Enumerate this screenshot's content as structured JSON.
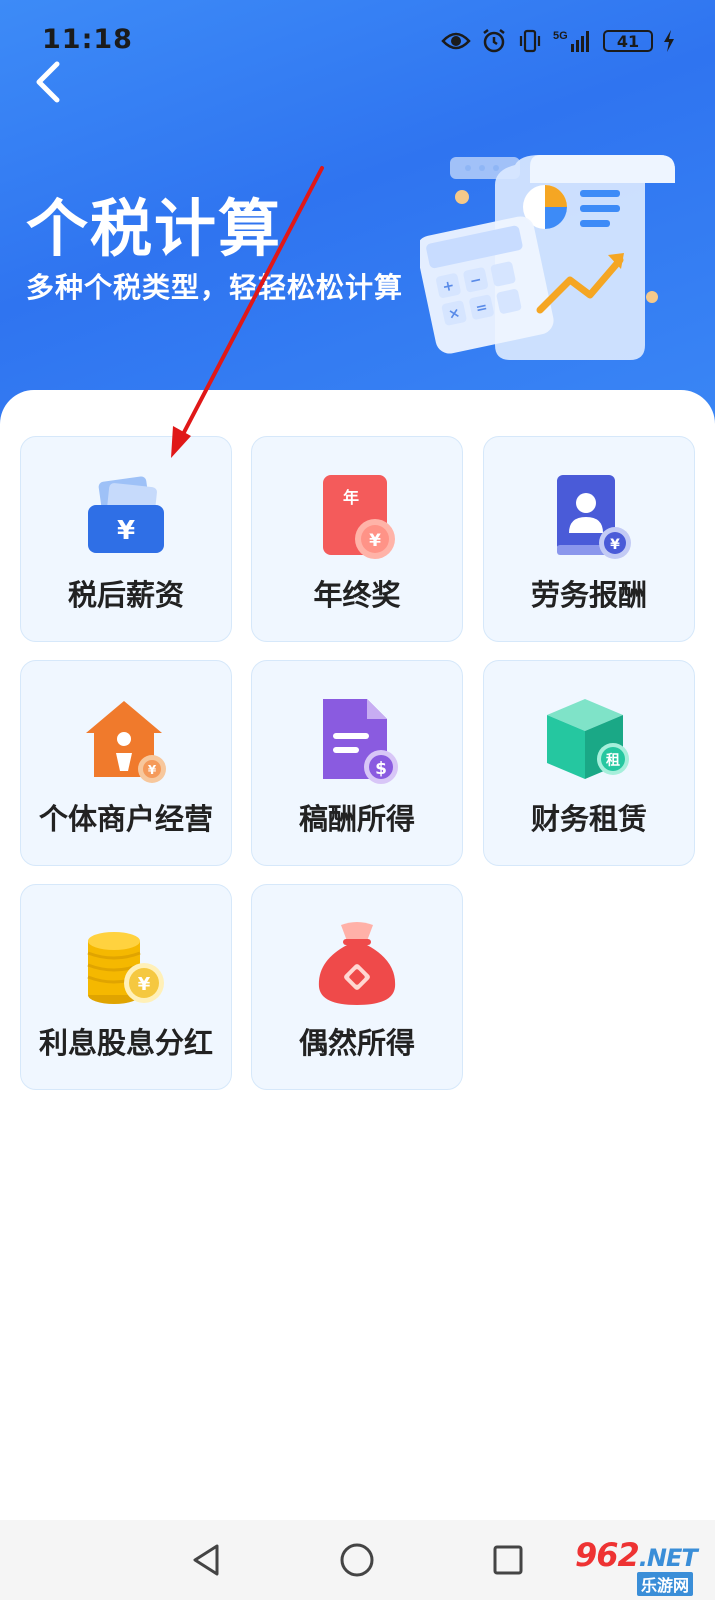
{
  "status_bar": {
    "time": "11:18",
    "network": "5G",
    "battery": "41"
  },
  "header": {
    "title": "个税计算",
    "subtitle": "多种个税类型，轻轻松松计算"
  },
  "grid": [
    {
      "label": "税后薪资",
      "icon": "wallet-yen-icon",
      "color": "#2f6fe6"
    },
    {
      "label": "年终奖",
      "icon": "red-envelope-year-icon",
      "color": "#f45b5b"
    },
    {
      "label": "劳务报酬",
      "icon": "contract-person-icon",
      "color": "#4a5bd8"
    },
    {
      "label": "个体商户经营",
      "icon": "shop-house-icon",
      "color": "#f07a2c"
    },
    {
      "label": "稿酬所得",
      "icon": "document-dollar-icon",
      "color": "#8a5be0"
    },
    {
      "label": "财务租赁",
      "icon": "rent-box-icon",
      "color": "#25c7a0"
    },
    {
      "label": "利息股息分红",
      "icon": "coin-stack-icon",
      "color": "#f5b800"
    },
    {
      "label": "偶然所得",
      "icon": "money-bag-icon",
      "color": "#ef4a4a"
    }
  ],
  "watermark": {
    "brand": "962",
    "suffix": ".NET",
    "sub": "乐游网"
  },
  "colors": {
    "header_blue": "#2f74f0",
    "tile_bg": "#f0f7ff",
    "annotation_red": "#e01818"
  }
}
